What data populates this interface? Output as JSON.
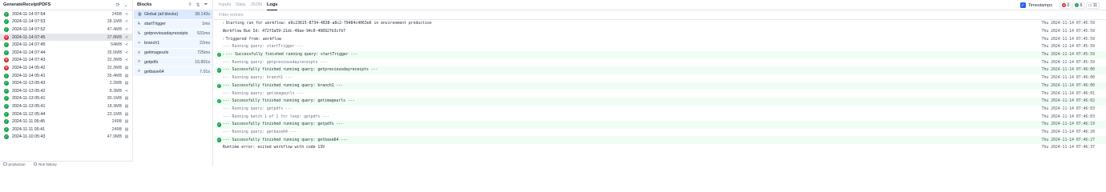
{
  "runs_panel": {
    "title": "GenerateReceiptPDFS",
    "runs": [
      {
        "date": "2024-11-14 07:54",
        "size": "249B",
        "status": "ok",
        "icon": "share-icon"
      },
      {
        "date": "2024-11-14 07:53",
        "size": "28.1MB",
        "status": "ok",
        "icon": "share-icon"
      },
      {
        "date": "2024-11-14 07:52",
        "size": "47.4MB",
        "status": "ok",
        "icon": "share-icon"
      },
      {
        "date": "2024-11-14 07:45",
        "size": "37.8MB",
        "status": "err",
        "icon": "share-icon"
      },
      {
        "date": "2024-11-14 07:45",
        "size": "54MB",
        "status": "ok",
        "icon": "share-icon"
      },
      {
        "date": "2024-11-14 07:44",
        "size": "35.5MB",
        "status": "ok",
        "icon": "share-icon"
      },
      {
        "date": "2024-11-14 07:43",
        "size": "32.3MB",
        "status": "err",
        "icon": "share-icon"
      },
      {
        "date": "2024-11-14 05:42",
        "size": "32.3MB",
        "status": "err",
        "icon": "calendar-icon"
      },
      {
        "date": "2024-11-14 05:41",
        "size": "35.4MB",
        "status": "ok",
        "icon": "calendar-icon"
      },
      {
        "date": "2024-11-13 05:43",
        "size": "2.2MB",
        "status": "ok",
        "icon": "calendar-icon"
      },
      {
        "date": "2024-11-13 05:42",
        "size": "8.3MB",
        "status": "ok",
        "icon": "share-icon"
      },
      {
        "date": "2024-11-13 05:41",
        "size": "30.1MB",
        "status": "ok",
        "icon": "calendar-icon"
      },
      {
        "date": "2024-11-13 05:41",
        "size": "18.3MB",
        "status": "ok",
        "icon": "calendar-icon"
      },
      {
        "date": "2024-11-12 05:44",
        "size": "23.1MB",
        "status": "ok",
        "icon": "calendar-icon"
      },
      {
        "date": "2024-11-11 05:45",
        "size": "249B",
        "status": "ok",
        "icon": "calendar-icon"
      },
      {
        "date": "2024-11-11 05:41",
        "size": "249B",
        "status": "ok",
        "icon": "calendar-icon"
      },
      {
        "date": "2024-11-10 05:43",
        "size": "47.9MB",
        "status": "ok",
        "icon": "calendar-icon"
      }
    ],
    "footer": {
      "production_label": "production",
      "run_history_label": "Run history"
    }
  },
  "blocks_panel": {
    "title": "Blocks",
    "blocks": [
      {
        "name": "Global (all blocks)",
        "time": "38.143s",
        "icon": "globe-icon"
      },
      {
        "name": "startTrigger",
        "time": "1ms",
        "icon": "bolt-icon"
      },
      {
        "name": "getpreviousdayreceipts",
        "time": "531ms",
        "icon": "bolt-icon"
      },
      {
        "name": "branch1",
        "time": "22ms",
        "icon": "branch-icon"
      },
      {
        "name": "getimageurls",
        "time": "725ms",
        "icon": "search-icon"
      },
      {
        "name": "getpdfs",
        "time": "15.801s",
        "icon": "search-icon"
      },
      {
        "name": "getbase64",
        "time": "7.01s",
        "icon": "search-icon"
      }
    ]
  },
  "main": {
    "tabs": [
      "Inputs",
      "Data",
      "JSON",
      "Logs"
    ],
    "active_tab": "Logs",
    "timestamps_label": "Timestamps",
    "badges": {
      "error": "0",
      "success": "6",
      "info": "11"
    },
    "filter_placeholder": "Filter entries",
    "logs": [
      {
        "msg": "Starting run for workflow: e9c23615-8734-4838-a8c2-79484c4063e6 in environment production",
        "ts": "Thu 2024-11-14 07:45:59",
        "kind": "caret"
      },
      {
        "msg": "Workflow Run Id: 472f3a59-21dc-49ae-94c0-498927b3cfb7",
        "ts": "Thu 2024-11-14 07:45:59",
        "kind": "plain"
      },
      {
        "msg": "Triggered from: workflow",
        "ts": "Thu 2024-11-14 07:45:59",
        "kind": "caret"
      },
      {
        "msg": "--- Running query: startTrigger ---",
        "ts": "Thu 2024-11-14 07:45:59",
        "kind": "dim"
      },
      {
        "msg": "--- Successfully finished running query: startTrigger ---",
        "ts": "Thu 2024-11-14 07:45:59",
        "kind": "succ-caret"
      },
      {
        "msg": "--- Running query: getpreviousdayreceipts ---",
        "ts": "Thu 2024-11-14 07:45:59",
        "kind": "dim"
      },
      {
        "msg": "--- Successfully finished running query: getpreviousdayreceipts ---",
        "ts": "Thu 2024-11-14 07:46:00",
        "kind": "succ"
      },
      {
        "msg": "--- Running query: branch1 ---",
        "ts": "Thu 2024-11-14 07:46:00",
        "kind": "dim"
      },
      {
        "msg": "--- Successfully finished running query: branch1 ---",
        "ts": "Thu 2024-11-14 07:46:00",
        "kind": "succ"
      },
      {
        "msg": "--- Running query: getimageurls ---",
        "ts": "Thu 2024-11-14 07:46:01",
        "kind": "dim"
      },
      {
        "msg": "--- Successfully finished running query: getimageurls ---",
        "ts": "Thu 2024-11-14 07:46:02",
        "kind": "succ"
      },
      {
        "msg": "--- Running query: getpdfs ---",
        "ts": "Thu 2024-11-14 07:46:03",
        "kind": "dim"
      },
      {
        "msg": "--- Running batch 1 of 1 for loop: getpdfs ---",
        "ts": "Thu 2024-11-14 07:46:03",
        "kind": "dim"
      },
      {
        "msg": "--- Successfully finished running query: getpdfs ---",
        "ts": "Thu 2024-11-14 07:46:19",
        "kind": "succ"
      },
      {
        "msg": "--- Running query: getbase64 ---",
        "ts": "Thu 2024-11-14 07:46:20",
        "kind": "dim"
      },
      {
        "msg": "--- Successfully finished running query: getbase64 ---",
        "ts": "Thu 2024-11-14 07:46:27",
        "kind": "succ"
      },
      {
        "msg": "Runtime error: exited workflow with code 139",
        "ts": "Thu 2024-11-14 07:46:37",
        "kind": "plain"
      }
    ]
  },
  "colors": {
    "success": "#16a34a",
    "error": "#dc2626",
    "accent": "#2563eb"
  }
}
